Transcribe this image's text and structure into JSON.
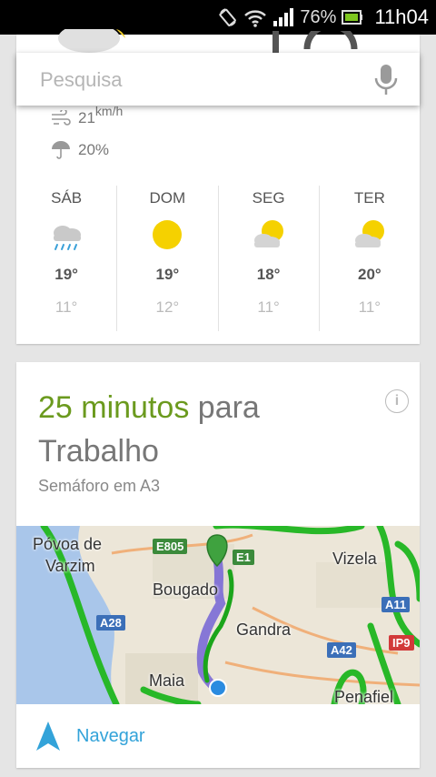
{
  "status_bar": {
    "battery_percent": "76%",
    "time": "11h04",
    "icons": [
      "rotation-icon",
      "wifi-icon",
      "signal-icon",
      "battery-icon"
    ]
  },
  "search": {
    "placeholder": "Pesquisa",
    "mic_icon": "microphone-icon"
  },
  "weather": {
    "wind": {
      "value": "21",
      "unit": "km/h",
      "icon": "wind-icon"
    },
    "precipitation": {
      "value": "20%",
      "icon": "umbrella-icon"
    },
    "forecast": [
      {
        "day": "SÁB",
        "icon": "rain-cloud-icon",
        "high": "19°",
        "low": "11°"
      },
      {
        "day": "DOM",
        "icon": "sun-icon",
        "high": "19°",
        "low": "12°"
      },
      {
        "day": "SEG",
        "icon": "partly-cloudy-icon",
        "high": "18°",
        "low": "11°"
      },
      {
        "day": "TER",
        "icon": "partly-cloudy-icon",
        "high": "20°",
        "low": "11°"
      }
    ]
  },
  "commute": {
    "duration": "25 minutos",
    "connector": "para",
    "destination": "Trabalho",
    "traffic": "Semáforo em A3",
    "info_icon": "info-icon",
    "map": {
      "labels": {
        "povoa": "Póvoa de",
        "varzim": "Varzim",
        "bougado": "Bougado",
        "vizela": "Vizela",
        "gandra": "Gandra",
        "maia": "Maia",
        "penafiel": "Penafiel"
      },
      "roads": {
        "e805": "E805",
        "e1": "E1",
        "a28": "A28",
        "a42": "A42",
        "a11": "A11",
        "ip9": "IP9"
      }
    },
    "navigate_label": "Navegar",
    "navigate_icon": "navigation-arrow-icon"
  }
}
